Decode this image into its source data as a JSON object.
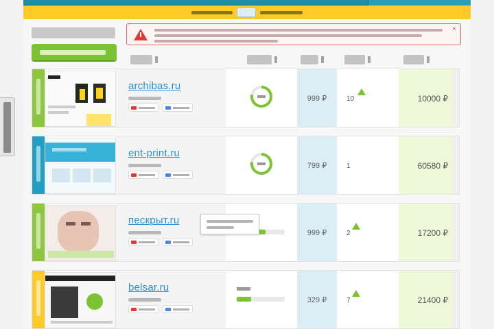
{
  "colors": {
    "header_teal": "#1f8fa6",
    "header_yellow": "#ffc928",
    "accent_green": "#7cc235",
    "link_blue": "#2a8fd6",
    "alert_red": "#e03a3a",
    "price_bg": "#dbeef6",
    "income_bg": "#eef9da"
  },
  "icons": {
    "alert": "warning-triangle-icon",
    "close": "close-icon",
    "ring": "rating-ring-icon",
    "growth": "up-arrow-icon"
  },
  "alert": {
    "close_symbol": "×"
  },
  "rows": [
    {
      "domain": "archibas.ru",
      "stripe_color": "#8ec63f",
      "rating_percent": 78,
      "price": "999 ₽",
      "sales": "10",
      "income": "10000 ₽"
    },
    {
      "domain": "ent-print.ru",
      "stripe_color": "#1f9fc3",
      "rating_percent": 78,
      "price": "799 ₽",
      "sales": "1",
      "income": "60580 ₽"
    },
    {
      "domain": "пескрыт.ru",
      "stripe_color": "#8ec63f",
      "rating_percent": 60,
      "price": "999 ₽",
      "sales": "2",
      "income": "17200 ₽"
    },
    {
      "domain": "belsar.ru",
      "stripe_color": "#ffc928",
      "rating_percent": 30,
      "price": "329 ₽",
      "sales": "7",
      "income": "21400 ₽"
    }
  ]
}
